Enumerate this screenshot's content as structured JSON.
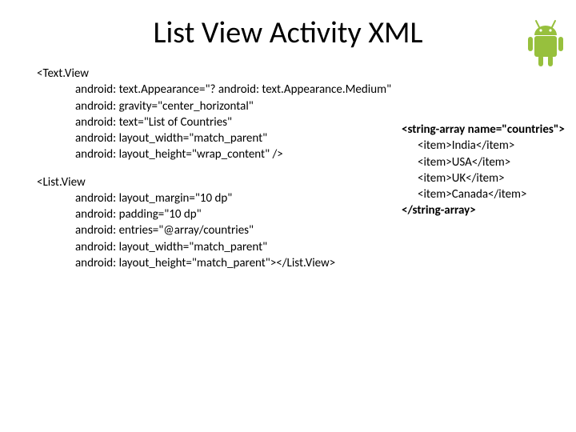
{
  "title": "List View Activity XML",
  "leftCode": {
    "textViewOpen": "<Text.View",
    "textViewAttrs": [
      "android: text.Appearance=\"? android: text.Appearance.Medium\"",
      "android: gravity=\"center_horizontal\"",
      "android: text=\"List of Countries\"",
      "android: layout_width=\"match_parent\"",
      "android: layout_height=\"wrap_content\" />"
    ],
    "listViewOpen": "<List.View",
    "listViewAttrs": [
      "android: layout_margin=\"10 dp\"",
      "android: padding=\"10 dp\"",
      "android: entries=\"@array/countries\"",
      "android: layout_width=\"match_parent\"",
      "android: layout_height=\"match_parent\"></List.View>"
    ]
  },
  "rightCode": {
    "arrayOpen": "<string-array name=\"countries\">",
    "items": [
      "<item>India</item>",
      "<item>USA</item>",
      "<item>UK</item>",
      "<item>Canada</item>"
    ],
    "arrayClose": "</string-array>"
  }
}
